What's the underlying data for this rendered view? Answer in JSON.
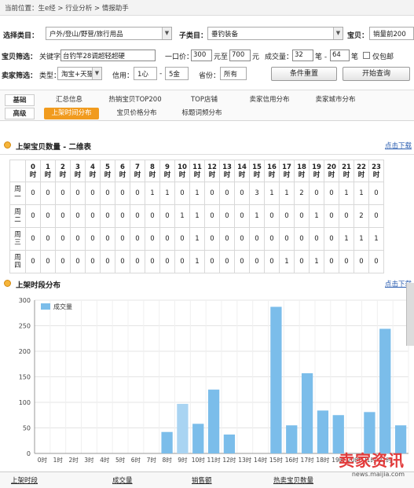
{
  "breadcrumb": {
    "text": "当前位置：生e经 > 行业分析 > 情报助手"
  },
  "filters": {
    "cat_label": "选择类目：",
    "category": "户外/登山/野营/旅行用品",
    "subcat_label": "子类目：",
    "subcategory": "垂钓装备",
    "item_label": "宝贝：",
    "item_sort": "销量前200",
    "product_label": "宝贝筛选：",
    "keyword_label": "关键字",
    "keyword": "台钓竿28调超轻超硬",
    "price_label": "一口价：",
    "price_min": "300",
    "price_to": "元至",
    "price_max": "700",
    "price_unit": "元",
    "volume_label": "成交量：",
    "volume_min": "32",
    "volume_to": "笔 -",
    "volume_max": "64",
    "volume_unit": "笔",
    "free_ship": "仅包邮",
    "seller_label": "卖家筛选：",
    "type_label": "类型：",
    "type": "淘宝+天猫",
    "credit_label": "信用：",
    "credit_min": "1心",
    "credit_max": "5金",
    "province_label": "省份：",
    "province": "所有",
    "reset_button": "条件重置",
    "query_button": "开始查询"
  },
  "tabs": {
    "basic_group": "基础",
    "advanced_group": "高级",
    "basic": [
      "汇总信息",
      "热销宝贝TOP200",
      "TOP店铺",
      "卖家信用分布",
      "卖家城市分布"
    ],
    "advanced": [
      "上架时间分布",
      "宝贝价格分布",
      "标题词频分布"
    ]
  },
  "grid_section": {
    "title": "上架宝贝数量 - 二维表",
    "download": "点击下载"
  },
  "grid": {
    "hours": [
      "0\n时",
      "1\n时",
      "2\n时",
      "3\n时",
      "4\n时",
      "5\n时",
      "6\n时",
      "7\n时",
      "8\n时",
      "9\n时",
      "10\n时",
      "11\n时",
      "12\n时",
      "13\n时",
      "14\n时",
      "15\n时",
      "16\n时",
      "17\n时",
      "18\n时",
      "19\n时",
      "20\n时",
      "21\n时",
      "22\n时",
      "23\n时"
    ],
    "rows": [
      {
        "day": "周一",
        "values": [
          "0",
          "0",
          "0",
          "0",
          "0",
          "0",
          "0",
          "0",
          "1",
          "1",
          "0",
          "1",
          "0",
          "0",
          "0",
          "3",
          "1",
          "1",
          "2",
          "0",
          "0",
          "1",
          "1",
          "0"
        ]
      },
      {
        "day": "周二",
        "values": [
          "0",
          "0",
          "0",
          "0",
          "0",
          "0",
          "0",
          "0",
          "0",
          "0",
          "1",
          "1",
          "0",
          "0",
          "0",
          "1",
          "0",
          "0",
          "0",
          "1",
          "0",
          "0",
          "2",
          "0"
        ]
      },
      {
        "day": "周三",
        "values": [
          "0",
          "0",
          "0",
          "0",
          "0",
          "0",
          "0",
          "0",
          "0",
          "0",
          "0",
          "1",
          "0",
          "0",
          "0",
          "0",
          "0",
          "0",
          "0",
          "0",
          "0",
          "1",
          "1",
          "1"
        ]
      },
      {
        "day": "周四",
        "values": [
          "0",
          "0",
          "0",
          "0",
          "0",
          "0",
          "0",
          "0",
          "0",
          "0",
          "0",
          "1",
          "0",
          "0",
          "0",
          "0",
          "0",
          "1",
          "0",
          "1",
          "0",
          "0",
          "0",
          "0"
        ]
      }
    ]
  },
  "chart_section": {
    "title": "上架时段分布",
    "download": "点击下载"
  },
  "chart_data": {
    "type": "bar",
    "legend": "成交量",
    "categories": [
      "0时",
      "1时",
      "2时",
      "3时",
      "4时",
      "5时",
      "6时",
      "7时",
      "8时",
      "9时",
      "10时",
      "11时",
      "12时",
      "13时",
      "14时",
      "15时",
      "16时",
      "17时",
      "18时",
      "19时",
      "20时",
      "21时",
      "22时"
    ],
    "values": [
      0,
      0,
      0,
      0,
      0,
      0,
      0,
      0,
      42,
      97,
      58,
      125,
      37,
      0,
      0,
      287,
      55,
      157,
      84,
      75,
      0,
      81,
      244
    ],
    "extra_value": 55,
    "ylim": [
      0,
      300
    ],
    "yticks": [
      "0",
      "50",
      "100",
      "150",
      "200",
      "250",
      "300"
    ],
    "colors": {
      "bar": "#7bbdea",
      "bar_light": "#a9d4f2",
      "grid": "#e4e4e4"
    }
  },
  "footer": {
    "cols": [
      "上架时段",
      "成交量",
      "销售额",
      "热卖宝贝数量"
    ]
  },
  "watermark": {
    "big": "卖家资讯",
    "small": "news.maijia.com"
  }
}
